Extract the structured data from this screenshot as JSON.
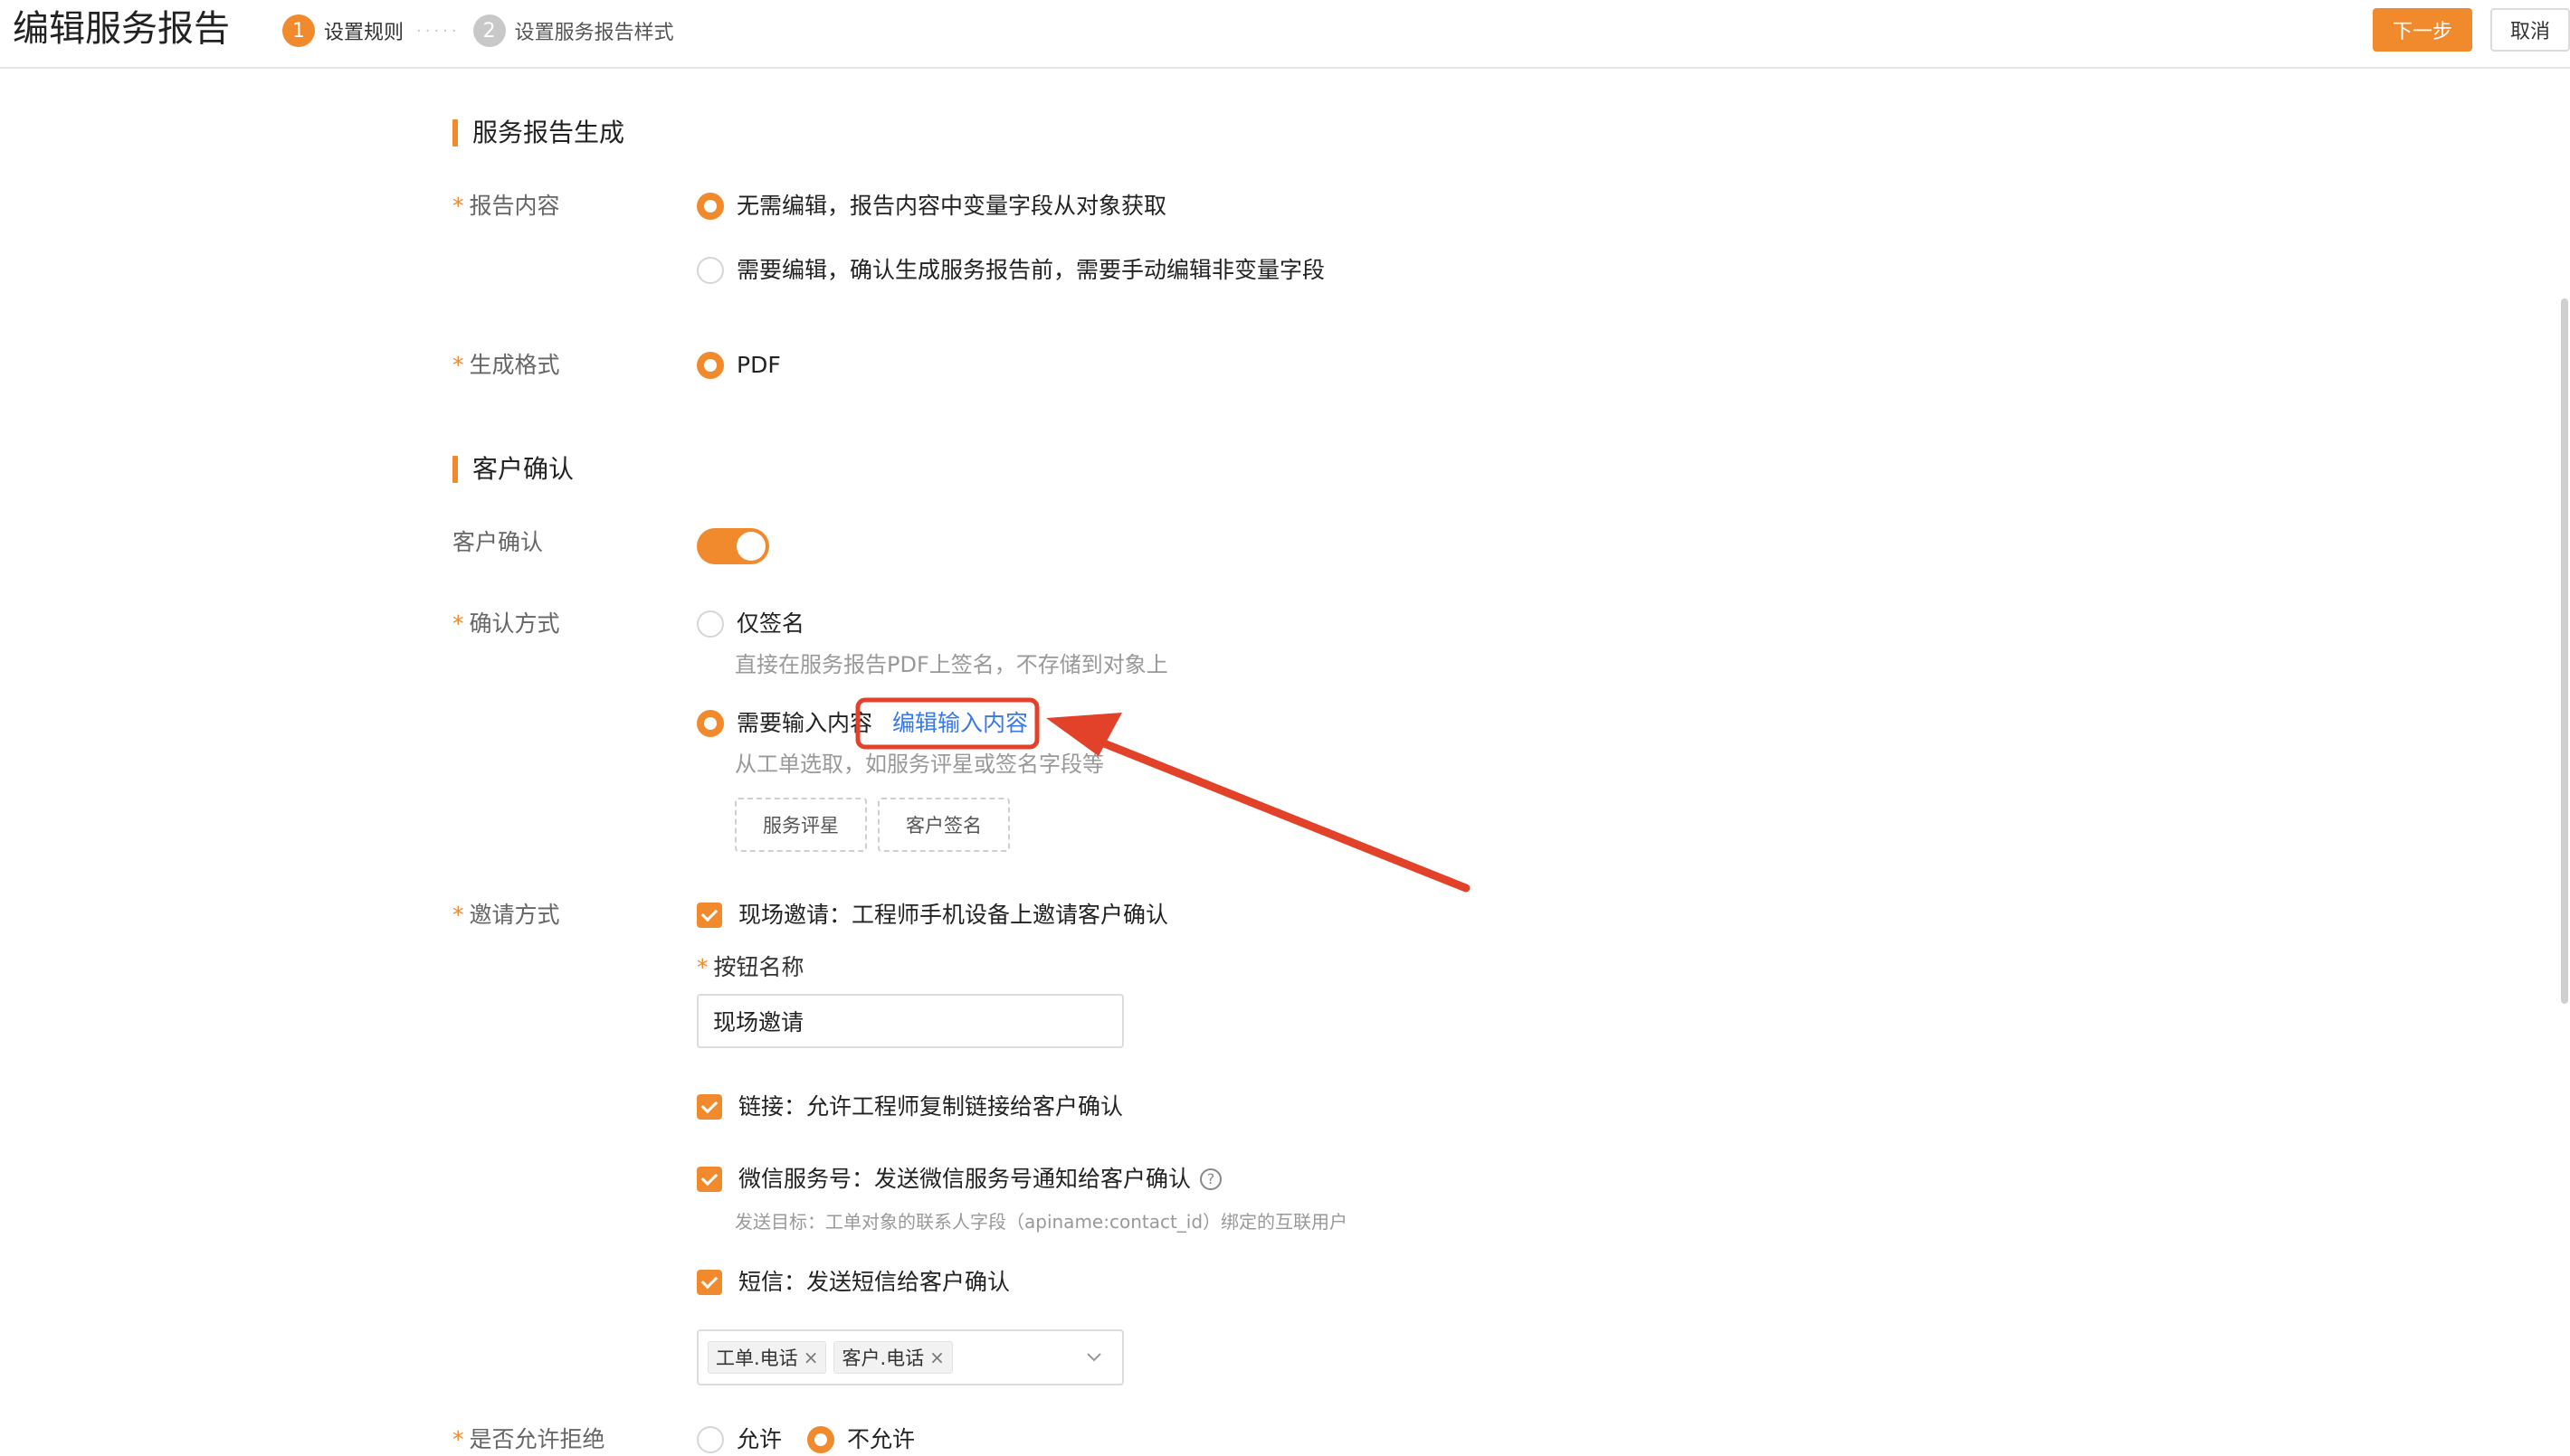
{
  "header": {
    "title": "编辑服务报告",
    "steps": [
      {
        "num": "1",
        "label": "设置规则"
      },
      {
        "num": "2",
        "label": "设置服务报告样式"
      }
    ],
    "next_label": "下一步",
    "cancel_label": "取消"
  },
  "report_section": {
    "title": "服务报告生成",
    "content_label": "报告内容",
    "content_options": [
      "无需编辑，报告内容中变量字段从对象获取",
      "需要编辑，确认生成服务报告前，需要手动编辑非变量字段"
    ],
    "format_label": "生成格式",
    "format_option": "PDF"
  },
  "confirm_section": {
    "title": "客户确认",
    "toggle_label": "客户确认",
    "method_label": "确认方式",
    "method_sign_only": "仅签名",
    "method_sign_only_hint": "直接在服务报告PDF上签名，不存储到对象上",
    "method_input": "需要输入内容",
    "method_input_link": "编辑输入内容",
    "method_input_hint": "从工单选取，如服务评星或签名字段等",
    "fields": [
      "服务评星",
      "客户签名"
    ],
    "invite_label": "邀请方式",
    "invite_onsite": "现场邀请：工程师手机设备上邀请客户确认",
    "button_name_label": "按钮名称",
    "button_name_value": "现场邀请",
    "invite_link": "链接：允许工程师复制链接给客户确认",
    "invite_wechat": "微信服务号：发送微信服务号通知给客户确认",
    "wechat_hint": "发送目标：工单对象的联系人字段（apiname:contact_id）绑定的互联用户",
    "invite_sms": "短信：发送短信给客户确认",
    "sms_targets": [
      "工单.电话",
      "客户.电话"
    ],
    "reject_label": "是否允许拒绝",
    "reject_allow": "允许",
    "reject_deny": "不允许"
  },
  "colors": {
    "accent": "#f08a2d",
    "link": "#3a78e6",
    "annotation": "#e2412a"
  },
  "icons": {
    "help": "?",
    "chip_remove": "×"
  }
}
